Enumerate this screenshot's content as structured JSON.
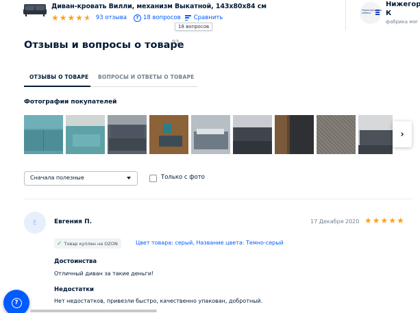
{
  "header": {
    "product_title": "Диван-кровать Вилли, механизм Выкатной, 143х80х84 см",
    "rating_stars": 4.5,
    "reviews_link": "93 отзыва",
    "questions_link": "18 вопросов",
    "compare_link": "Сравнить",
    "tooltip": "18 вопросов",
    "seller_name": "Нижегоро",
    "seller_name_line2": "К",
    "seller_subtitle": "фабрика мяг",
    "seller_logo_text": "Нижегородская мебель"
  },
  "section": {
    "title": "Отзывы и вопросы о товаре",
    "count": "93"
  },
  "tabs": [
    {
      "label": "ОТЗЫВЫ О ТОВАРЕ",
      "active": true
    },
    {
      "label": "ВОПРОСЫ И ОТВЕТЫ О ТОВАРЕ",
      "active": false
    }
  ],
  "photos": {
    "title": "Фотографии покупателей",
    "next_icon": "chevron-right-icon"
  },
  "filters": {
    "sort_value": "Сначала полезные",
    "only_photo_label": "Только с фото",
    "only_photo_checked": false
  },
  "review": {
    "avatar_letter": "Е",
    "author": "Евгения П.",
    "date": "17 Декабря 2020",
    "stars": 5,
    "purchased_badge": "Товар куплен на OZON",
    "variant": "Цвет товара: серый, Название цвета: Темно-серый",
    "pros_title": "Достоинства",
    "pros_text": "Отличный диван за такие деньги!",
    "cons_title": "Недостатки",
    "cons_text": "Нет недостатков, привезли быстро, качественно упакован, добротный."
  },
  "colors": {
    "accent": "#005bff",
    "star": "#f9a31b",
    "check": "#10c44c",
    "text": "#001a34",
    "muted": "#707f8d"
  }
}
